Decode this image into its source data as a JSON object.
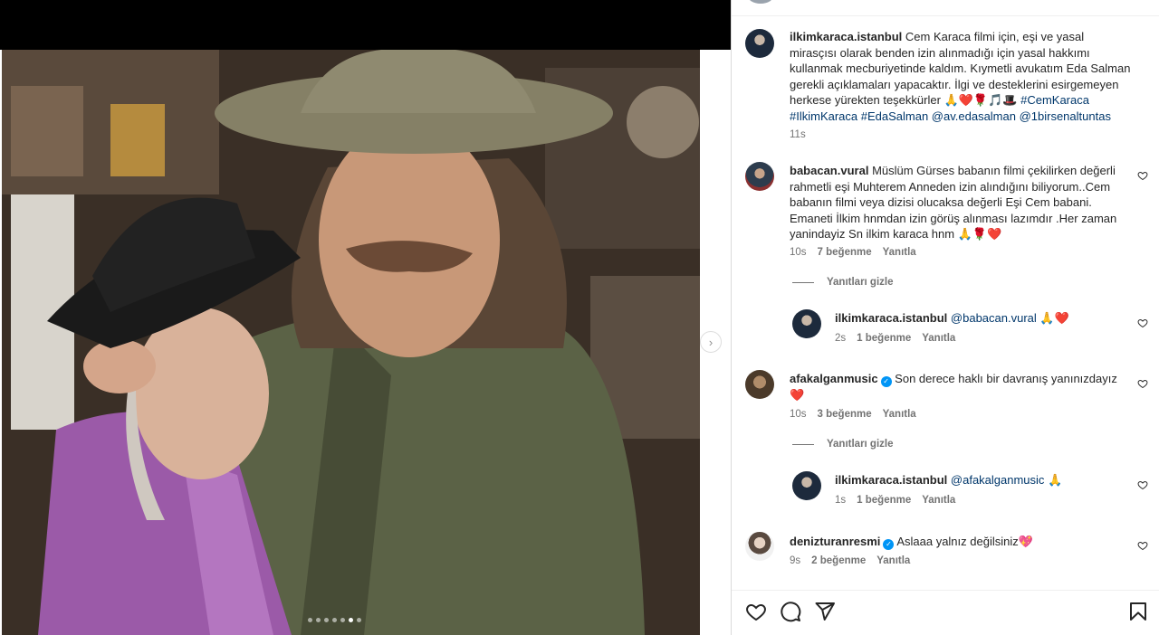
{
  "post": {
    "carousel": {
      "dot_count": 7,
      "active_index": 5
    }
  },
  "caption": {
    "username": "ilkimkaraca.istanbul",
    "text": "Cem Karaca filmi için, eşi ve yasal mirasçısı olarak benden izin alınmadığı için yasal hakkımı kullanmak mecburiyetinde kaldım. Kıymetli avukatım Eda Salman gerekli açıklamaları yapacaktır. İlgi ve desteklerini esirgemeyen herkese yürekten teşekkürler 🙏❤️🌹🎵🎩",
    "tags": "#CemKaraca #IlkimKaraca #EdaSalman @av.edasalman @1birsenaltuntas",
    "time": "11s"
  },
  "comments": [
    {
      "username": "babacan.vural",
      "text": "Müslüm Gürses babanın filmi çekilirken değerli rahmetli eşi Muhterem Anneden izin alındığını biliyorum..Cem babanın filmi veya dizisi olucaksa değerli Eşi Cem babani. Emaneti İlkim hnmdan izin görüş alınması lazımdır .Her zaman yanindayiz Sn ilkim karaca hnm 🙏🌹❤️",
      "time": "10s",
      "likes": "7 beğenme",
      "reply": "Yanıtla",
      "hide_replies": "Yanıtları gizle",
      "replies": [
        {
          "username": "ilkimkaraca.istanbul",
          "mention": "@babacan.vural",
          "emoji": "🙏❤️",
          "time": "2s",
          "likes": "1 beğenme",
          "reply": "Yanıtla"
        }
      ]
    },
    {
      "username": "afakalganmusic",
      "verified": true,
      "text": "Son derece haklı bir davranış yanınızdayız ❤️",
      "time": "10s",
      "likes": "3 beğenme",
      "reply": "Yanıtla",
      "hide_replies": "Yanıtları gizle",
      "replies": [
        {
          "username": "ilkimkaraca.istanbul",
          "mention": "@afakalganmusic",
          "emoji": "🙏",
          "time": "1s",
          "likes": "1 beğenme",
          "reply": "Yanıtla"
        }
      ]
    },
    {
      "username": "denizturanresmi",
      "verified": true,
      "text": "Aslaaa yalnız değilsiniz💖",
      "time": "9s",
      "likes": "2 beğenme",
      "reply": "Yanıtla"
    }
  ],
  "icons": {
    "like": "heart-icon",
    "comment": "comment-icon",
    "share": "paper-plane-icon",
    "save": "bookmark-icon",
    "next": "chevron-right-icon"
  },
  "colors": {
    "hashtag": "#00376b",
    "meta": "#737373",
    "verified": "#0095f6",
    "heart": "#ed4956"
  }
}
